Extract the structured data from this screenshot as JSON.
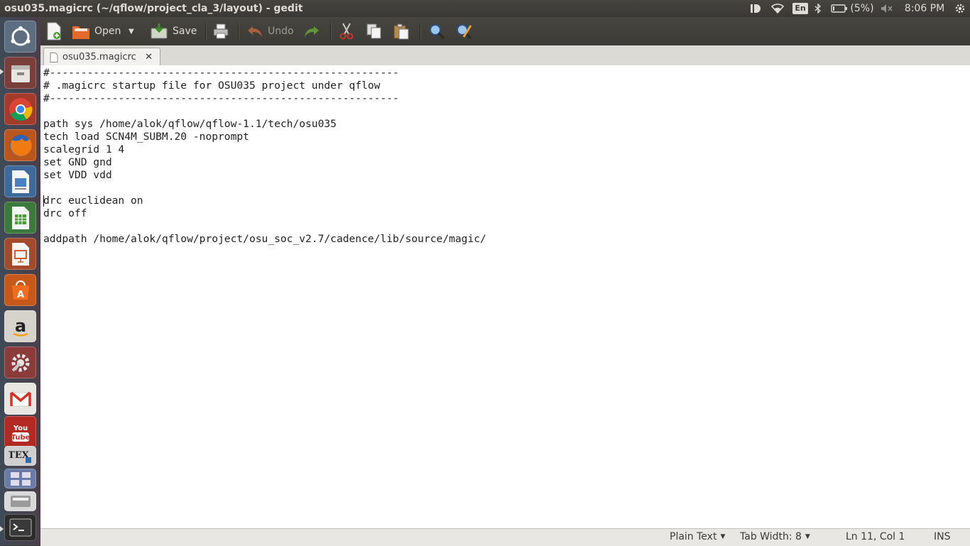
{
  "window": {
    "title": "osu035.magicrc (~/qflow/project_cla_3/layout) - gedit"
  },
  "tray": {
    "battery_percent": "(5%)",
    "keyboard_layout": "En",
    "clock": "8:06 PM"
  },
  "toolbar": {
    "open_label": "Open",
    "save_label": "Save",
    "undo_label": "Undo"
  },
  "tab": {
    "label": "osu035.magicrc",
    "close_glyph": "✕"
  },
  "editor": {
    "lines": [
      "#--------------------------------------------------------",
      "# .magicrc startup file for OSU035 project under qflow",
      "#--------------------------------------------------------",
      "",
      "path sys /home/alok/qflow/qflow-1.1/tech/osu035",
      "tech load SCN4M_SUBM.20 -noprompt",
      "scalegrid 1 4",
      "set GND gnd",
      "set VDD vdd",
      "",
      "drc euclidean on",
      "drc off",
      "",
      "addpath /home/alok/qflow/project/osu_soc_v2.7/cadence/lib/source/magic/"
    ]
  },
  "statusbar": {
    "language": "Plain Text",
    "tab_width": "Tab Width: 8",
    "position": "Ln 11, Col 1",
    "mode": "INS"
  },
  "launcher": {
    "items": [
      "dash-icon",
      "files-icon",
      "chrome-icon",
      "firefox-icon",
      "writer-icon",
      "calc-icon",
      "impress-icon",
      "software-center-icon",
      "amazon-icon",
      "settings-icon",
      "gmail-icon",
      "youtube-icon",
      "tex-icon",
      "workspace-icon",
      "terminal-icon"
    ]
  }
}
